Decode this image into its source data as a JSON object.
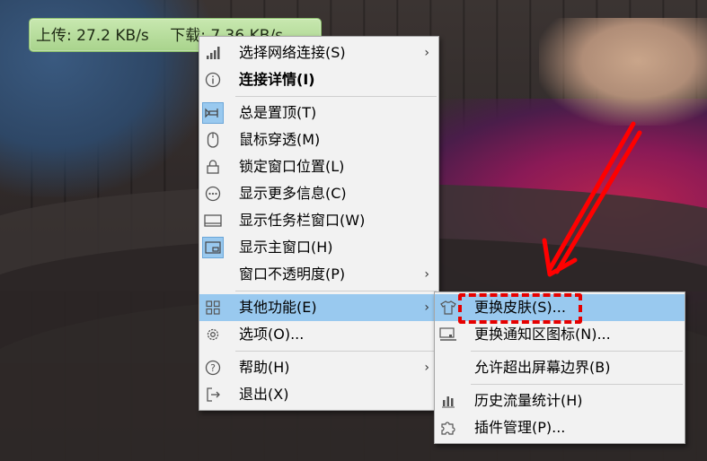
{
  "speed_bar": {
    "upload": "上传: 27.2 KB/s",
    "download": "下载: 7.36 KB/s"
  },
  "context_menu": {
    "items": [
      {
        "label": "选择网络连接(S)",
        "icon": "signal-bars-icon",
        "submenu": true
      },
      {
        "label": "连接详情(I)",
        "icon": "info-circle-icon",
        "bold": true
      },
      {
        "label": "总是置顶(T)",
        "icon": "pin-icon",
        "checked": true
      },
      {
        "label": "鼠标穿透(M)",
        "icon": "mouse-icon"
      },
      {
        "label": "锁定窗口位置(L)",
        "icon": "lock-icon"
      },
      {
        "label": "显示更多信息(C)",
        "icon": "more-dots-icon"
      },
      {
        "label": "显示任务栏窗口(W)",
        "icon": "taskbar-icon"
      },
      {
        "label": "显示主窗口(H)",
        "icon": "main-window-icon",
        "checked": true
      },
      {
        "label": "窗口不透明度(P)",
        "submenu": true
      },
      {
        "label": "其他功能(E)",
        "icon": "grid-icon",
        "submenu": true,
        "active": true
      },
      {
        "label": "选项(O)...",
        "icon": "gear-icon"
      },
      {
        "label": "帮助(H)",
        "icon": "help-icon",
        "submenu": true
      },
      {
        "label": "退出(X)",
        "icon": "exit-icon"
      }
    ]
  },
  "submenu": {
    "items": [
      {
        "label": "更换皮肤(S)...",
        "icon": "tshirt-icon",
        "active": true
      },
      {
        "label": "更换通知区图标(N)...",
        "icon": "tray-icon"
      },
      {
        "label": "允许超出屏幕边界(B)"
      },
      {
        "label": "历史流量统计(H)",
        "icon": "bar-chart-icon"
      },
      {
        "label": "插件管理(P)...",
        "icon": "puzzle-icon"
      }
    ]
  },
  "colors": {
    "highlight": "#99c9ef",
    "annotation": "#e60000",
    "speed_bar_bg": "#b5dc98"
  }
}
